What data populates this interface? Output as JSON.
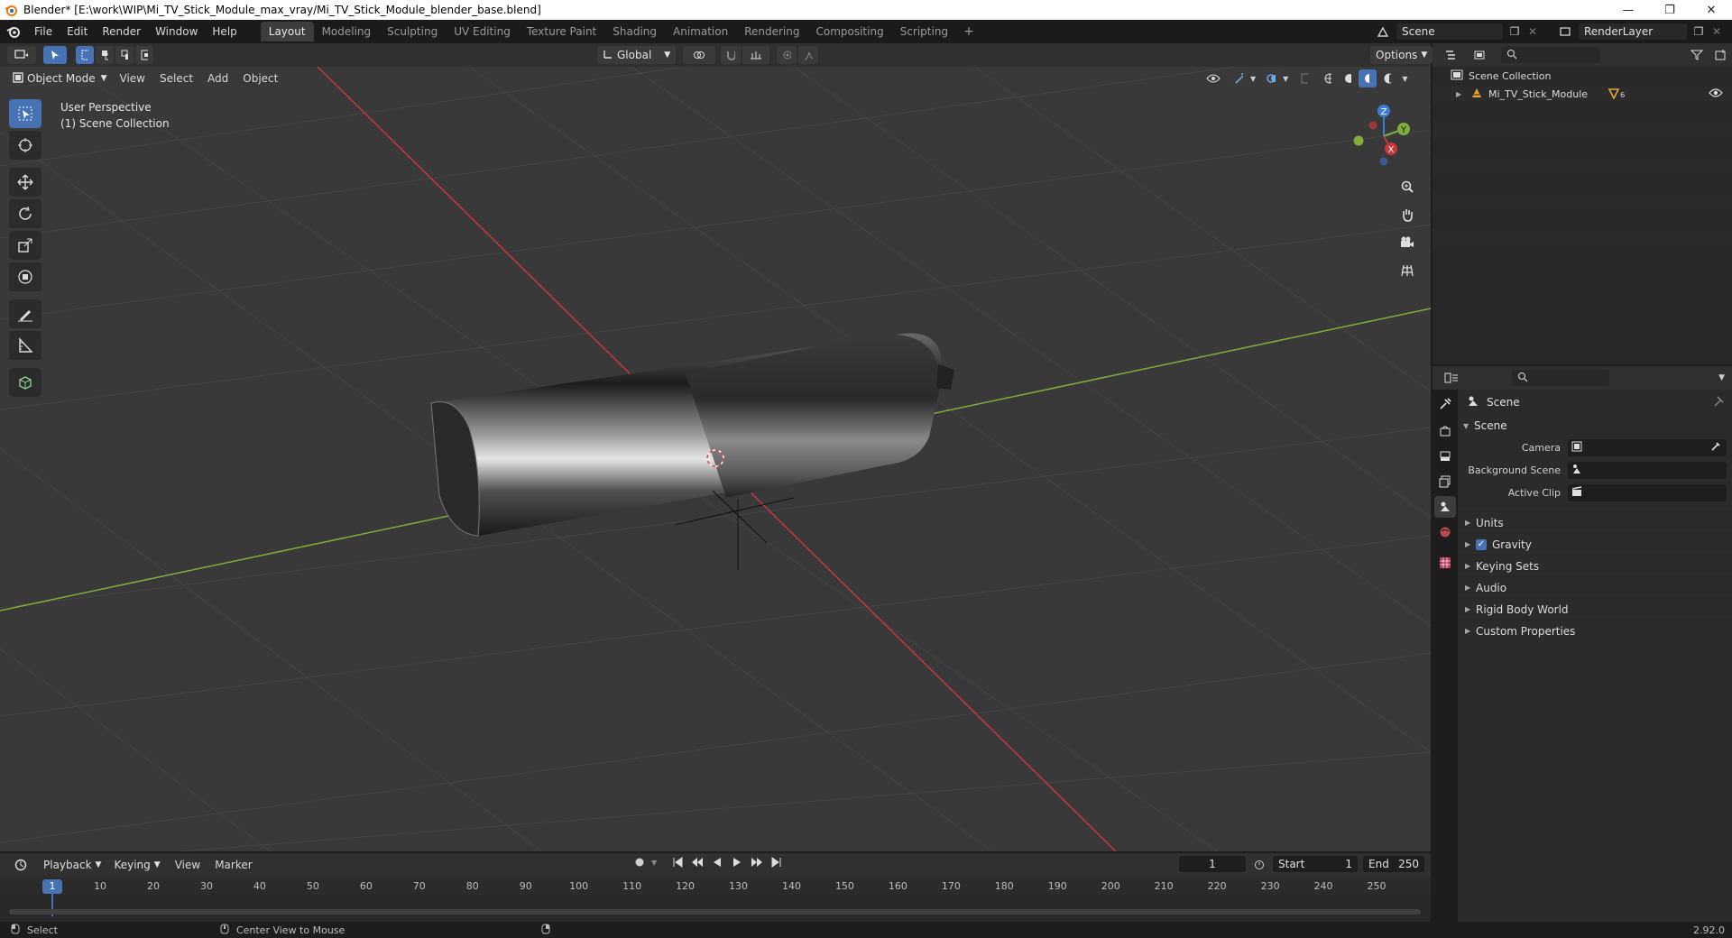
{
  "window": {
    "title": "Blender* [E:\\work\\WIP\\Mi_TV_Stick_Module_max_vray/Mi_TV_Stick_Module_blender_base.blend]",
    "minimize": "—",
    "maximize": "❐",
    "close": "✕"
  },
  "menu": [
    "File",
    "Edit",
    "Render",
    "Window",
    "Help"
  ],
  "workspaces": [
    "Layout",
    "Modeling",
    "Sculpting",
    "UV Editing",
    "Texture Paint",
    "Shading",
    "Animation",
    "Rendering",
    "Compositing",
    "Scripting"
  ],
  "active_workspace": "Layout",
  "scene_selector": {
    "scene": "Scene",
    "view_layer": "RenderLayer"
  },
  "viewport_header": {
    "transform_orientation": "Global",
    "options": "Options",
    "mode": "Object Mode",
    "menus": [
      "View",
      "Select",
      "Add",
      "Object"
    ]
  },
  "viewport": {
    "perspective": "User Perspective",
    "collection": "(1) Scene Collection",
    "axis_labels": {
      "x": "X",
      "y": "Y",
      "z": "Z"
    }
  },
  "outliner": {
    "root": "Scene Collection",
    "items": [
      {
        "name": "Mi_TV_Stick_Module",
        "modifier_count": "6"
      }
    ]
  },
  "properties": {
    "context": "Scene",
    "panel": "Scene",
    "fields": [
      {
        "label": "Camera",
        "value": ""
      },
      {
        "label": "Background Scene",
        "value": ""
      },
      {
        "label": "Active Clip",
        "value": ""
      }
    ],
    "subpanels": [
      {
        "label": "Units",
        "checkbox": false
      },
      {
        "label": "Gravity",
        "checkbox": true
      },
      {
        "label": "Keying Sets",
        "checkbox": false
      },
      {
        "label": "Audio",
        "checkbox": false
      },
      {
        "label": "Rigid Body World",
        "checkbox": false
      },
      {
        "label": "Custom Properties",
        "checkbox": false
      }
    ]
  },
  "timeline": {
    "menus": [
      "Playback",
      "Keying",
      "View",
      "Marker"
    ],
    "current_frame": "1",
    "start_label": "Start",
    "start": "1",
    "end_label": "End",
    "end": "250",
    "ticks": [
      "1",
      "10",
      "20",
      "30",
      "40",
      "50",
      "60",
      "70",
      "80",
      "90",
      "100",
      "110",
      "120",
      "130",
      "140",
      "150",
      "160",
      "170",
      "180",
      "190",
      "200",
      "210",
      "220",
      "230",
      "240",
      "250"
    ]
  },
  "statusbar": {
    "left_action": "Select",
    "middle_action": "Center View to Mouse",
    "version": "2.92.0"
  },
  "colors": {
    "accent": "#4772b3",
    "x_axis": "#c8383a",
    "y_axis": "#7fae3a",
    "z_axis": "#3d7cd6",
    "orange": "#e8a23a"
  }
}
